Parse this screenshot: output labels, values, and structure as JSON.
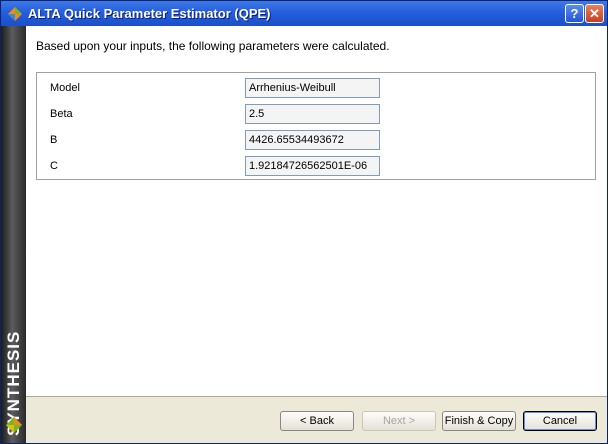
{
  "window": {
    "title": "ALTA Quick Parameter Estimator (QPE)",
    "help_label": "?",
    "close_label": "✕"
  },
  "sidebar": {
    "brand": "SYNTHESIS"
  },
  "main": {
    "intro": "Based upon your inputs, the following parameters were calculated.",
    "params": [
      {
        "label": "Model",
        "value": "Arrhenius-Weibull"
      },
      {
        "label": "Beta",
        "value": "2.5"
      },
      {
        "label": "B",
        "value": "4426.65534493672"
      },
      {
        "label": "C",
        "value": "1.92184726562501E-06"
      }
    ]
  },
  "buttons": {
    "back": "< Back",
    "next": "Next >",
    "finish": "Finish & Copy",
    "cancel": "Cancel"
  },
  "colors": {
    "title_bar": "#245ede",
    "sidebar_dark": "#1b1b1b",
    "logo_green": "#7ab51d",
    "logo_orange": "#f08a1c"
  }
}
